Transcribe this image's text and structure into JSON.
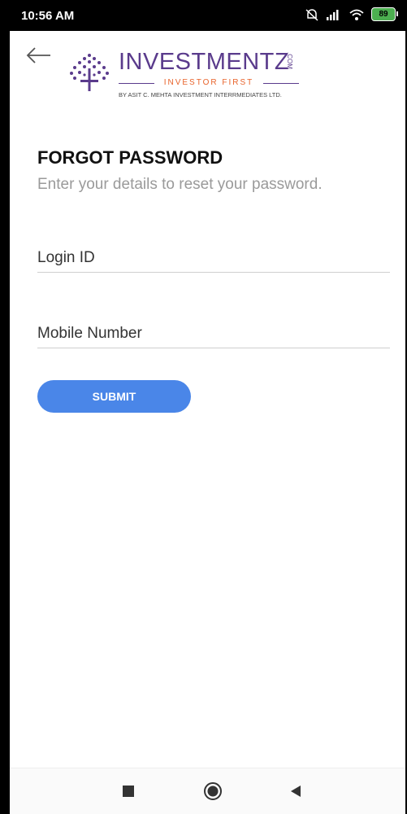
{
  "status_bar": {
    "time": "10:56 AM",
    "battery": "89"
  },
  "logo": {
    "brand": "INVESTMENTZ",
    "suffix": ".COM",
    "tagline": "INVESTOR FIRST",
    "subtitle": "BY ASIT C. MEHTA INVESTMENT INTERRMEDIATES LTD."
  },
  "form": {
    "title": "FORGOT PASSWORD",
    "subtitle": "Enter your details to reset your password.",
    "login_id_placeholder": "Login ID",
    "mobile_placeholder": "Mobile Number",
    "submit_label": "SUBMIT"
  },
  "colors": {
    "accent": "#4a86e8",
    "brand_purple": "#5a3b8c",
    "brand_orange": "#e8632b",
    "battery_green": "#4caf50"
  },
  "icons": [
    "back-arrow-icon",
    "dnd-icon",
    "signal-icon",
    "wifi-icon",
    "battery-icon",
    "recents-icon",
    "home-icon",
    "back-nav-icon"
  ]
}
